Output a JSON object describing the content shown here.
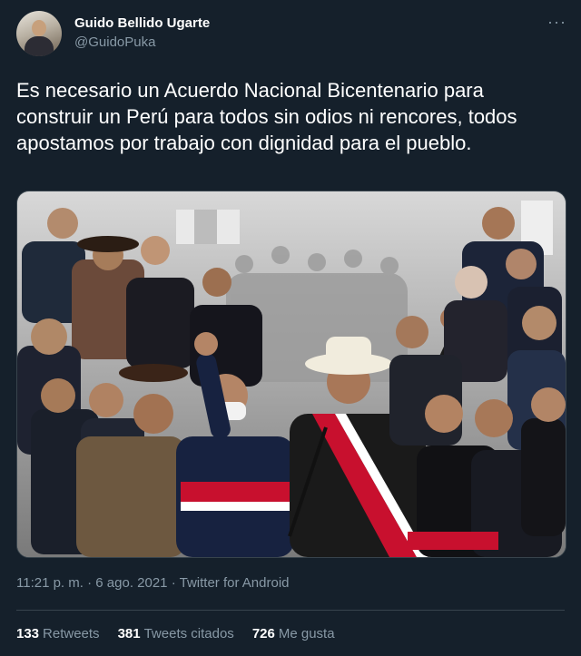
{
  "author": {
    "name": "Guido Bellido Ugarte",
    "handle": "@GuidoPuka"
  },
  "menu_icon": "more-horizontal-icon",
  "tweet": {
    "text": "Es necesario un Acuerdo Nacional Bicentenario para construir un Perú para todos sin odios ni rencores, todos apostamos por trabajo con dignidad para el pueblo."
  },
  "meta": {
    "time": "11:21 p. m.",
    "separator1": "·",
    "date": "6 ago. 2021",
    "separator2": "·",
    "source": "Twitter for Android"
  },
  "stats": {
    "retweets_count": "133",
    "retweets_label": "Retweets",
    "quotes_count": "381",
    "quotes_label": "Tweets citados",
    "likes_count": "726",
    "likes_label": "Me gusta"
  },
  "colors": {
    "background": "#15202b",
    "secondary_text": "#8899a6",
    "border": "#38444d",
    "sash_red": "#c8102e"
  }
}
